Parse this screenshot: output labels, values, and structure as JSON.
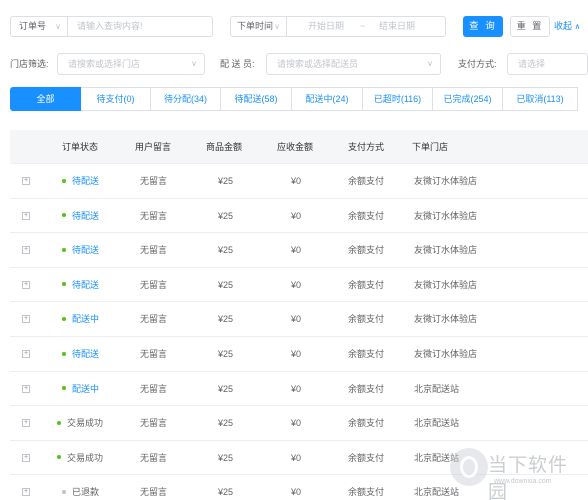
{
  "filters": {
    "order_select": "订单号",
    "query_placeholder": "请输入查询内容!",
    "time_select": "下单时间",
    "start_date": "开始日期",
    "range_sep": "~",
    "end_date": "结束日期",
    "query_button": "查 询",
    "reset_button": "重 置",
    "collapse_link": "收起"
  },
  "filters2": {
    "store_label": "门店筛选:",
    "store_placeholder": "请搜索或选择门店",
    "courier_label": "配 送 员:",
    "courier_placeholder": "请搜索或选择配送员",
    "payment_label": "支付方式:",
    "payment_placeholder": "请选择"
  },
  "tabs": [
    {
      "label": "全部"
    },
    {
      "label": "待支付(0)"
    },
    {
      "label": "待分配(34)"
    },
    {
      "label": "待配送(58)"
    },
    {
      "label": "配送中(24)"
    },
    {
      "label": "已超时(116)"
    },
    {
      "label": "已完成(254)"
    },
    {
      "label": "已取消(113)"
    }
  ],
  "table": {
    "headers": [
      "订单状态",
      "用户留言",
      "商品金额",
      "应收金额",
      "支付方式",
      "下单门店"
    ],
    "rows": [
      {
        "status": "待配送",
        "message": "无留言",
        "goods_amount": "¥25",
        "receivable": "¥0",
        "payment": "余额支付",
        "store": "友微订水体验店"
      },
      {
        "status": "待配送",
        "message": "无留言",
        "goods_amount": "¥25",
        "receivable": "¥0",
        "payment": "余额支付",
        "store": "友微订水体验店"
      },
      {
        "status": "待配送",
        "message": "无留言",
        "goods_amount": "¥25",
        "receivable": "¥0",
        "payment": "余额支付",
        "store": "友微订水体验店"
      },
      {
        "status": "待配送",
        "message": "无留言",
        "goods_amount": "¥25",
        "receivable": "¥0",
        "payment": "余额支付",
        "store": "友微订水体验店"
      },
      {
        "status": "配送中",
        "message": "无留言",
        "goods_amount": "¥25",
        "receivable": "¥0",
        "payment": "余额支付",
        "store": "友微订水体验店"
      },
      {
        "status": "待配送",
        "message": "无留言",
        "goods_amount": "¥25",
        "receivable": "¥0",
        "payment": "余额支付",
        "store": "友微订水体验店"
      },
      {
        "status": "配送中",
        "message": "无留言",
        "goods_amount": "¥25",
        "receivable": "¥0",
        "payment": "余额支付",
        "store": "北京配送站"
      },
      {
        "status": "交易成功",
        "message": "无留言",
        "goods_amount": "¥25",
        "receivable": "¥0",
        "payment": "余额支付",
        "store": "北京配送站"
      },
      {
        "status": "交易成功",
        "message": "无留言",
        "goods_amount": "¥25",
        "receivable": "¥0",
        "payment": "余额支付",
        "store": "北京配送站"
      },
      {
        "status": "已退款",
        "message": "无留言",
        "goods_amount": "¥25",
        "receivable": "¥0",
        "payment": "余额支付",
        "store": "北京配送站"
      }
    ]
  },
  "watermark": {
    "text": "当下软件园",
    "url": "www.downxia.com"
  },
  "colors": {
    "accent": "#1890ff",
    "status_dot": "#52c41a",
    "refund_dot": "#c0c4cc"
  }
}
